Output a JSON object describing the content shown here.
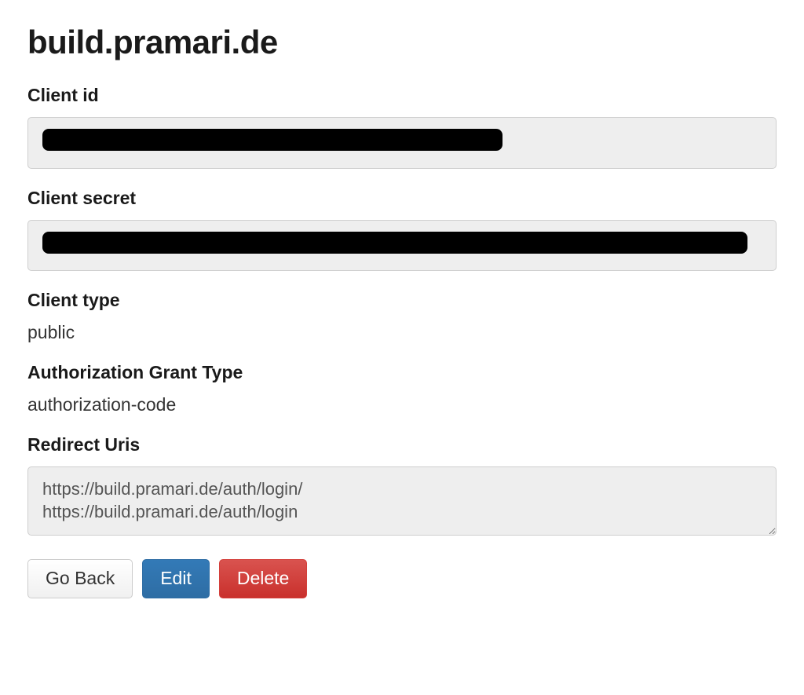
{
  "page": {
    "title": "build.pramari.de"
  },
  "labels": {
    "client_id": "Client id",
    "client_secret": "Client secret",
    "client_type": "Client type",
    "grant_type": "Authorization Grant Type",
    "redirect_uris": "Redirect Uris"
  },
  "values": {
    "client_id_redacted": true,
    "client_id_redaction_width_pct": 64,
    "client_secret_redacted": true,
    "client_secret_redaction_width_pct": 98,
    "client_type": "public",
    "grant_type": "authorization-code",
    "redirect_uris": "https://build.pramari.de/auth/login/\nhttps://build.pramari.de/auth/login"
  },
  "buttons": {
    "go_back": "Go Back",
    "edit": "Edit",
    "delete": "Delete"
  }
}
